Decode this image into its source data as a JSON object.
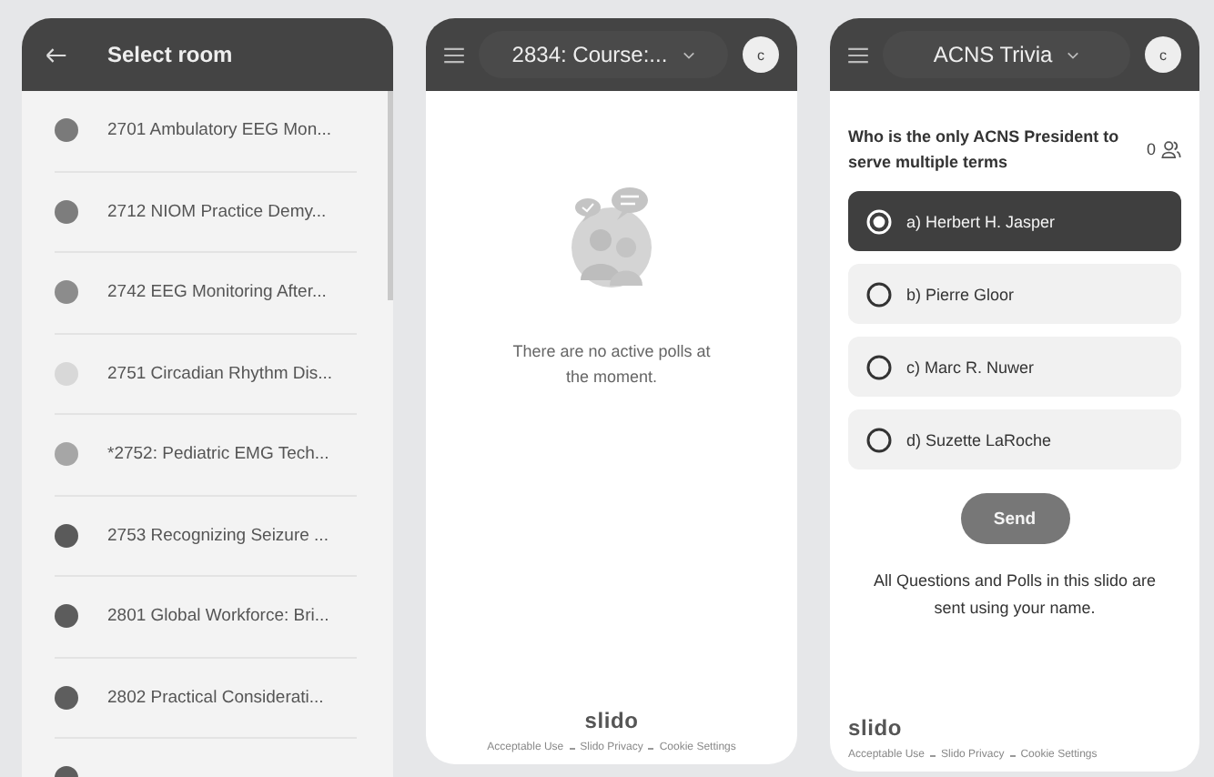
{
  "room_list": {
    "title": "Select room",
    "rooms": [
      {
        "label": "2701 Ambulatory EEG Mon...",
        "color": "#7a7a7a"
      },
      {
        "label": "2712 NIOM Practice Demy...",
        "color": "#7d7d7d"
      },
      {
        "label": "2742 EEG Monitoring After...",
        "color": "#8c8c8c"
      },
      {
        "label": "2751 Circadian Rhythm Dis...",
        "color": "#d8d8d8"
      },
      {
        "label": "*2752: Pediatric EMG Tech...",
        "color": "#a6a6a6"
      },
      {
        "label": "2753 Recognizing Seizure ...",
        "color": "#5a5a5a"
      },
      {
        "label": "2801 Global Workforce: Bri...",
        "color": "#5c5c5c"
      },
      {
        "label": "2802 Practical Considerati...",
        "color": "#5e5e5e"
      },
      {
        "color": "#5e5e5e"
      }
    ]
  },
  "polls_screen": {
    "event": "2834: Course:...",
    "avatar": "c",
    "empty_message": "There are no active polls at the moment.",
    "logo": "slido",
    "footer_links": [
      "Acceptable Use",
      "Slido Privacy",
      "Cookie Settings"
    ]
  },
  "trivia_screen": {
    "event": "ACNS Trivia",
    "avatar": "c",
    "question": "Who is the only ACNS President to serve multiple terms",
    "participants": "0",
    "options": [
      {
        "label": "a) Herbert H. Jasper",
        "selected": true
      },
      {
        "label": "b) Pierre Gloor",
        "selected": false
      },
      {
        "label": "c) Marc R. Nuwer",
        "selected": false
      },
      {
        "label": "d) Suzette LaRoche",
        "selected": false
      }
    ],
    "send_button": "Send",
    "note": "All Questions and Polls in this slido are sent using your name.",
    "logo": "slido",
    "footer_links": [
      "Acceptable Use",
      "Slido Privacy",
      "Cookie Settings"
    ]
  }
}
